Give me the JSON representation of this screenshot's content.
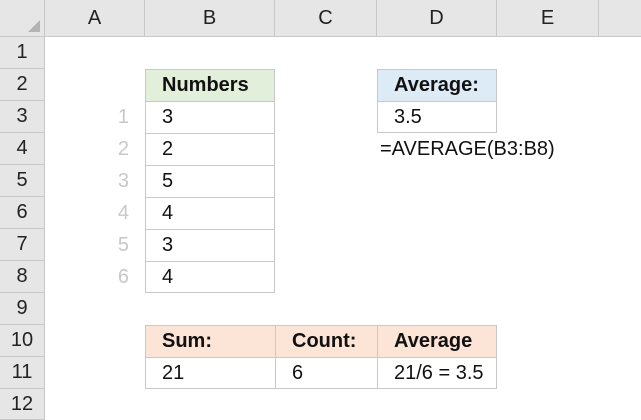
{
  "columns": [
    "A",
    "B",
    "C",
    "D",
    "E"
  ],
  "rows": [
    "1",
    "2",
    "3",
    "4",
    "5",
    "6",
    "7",
    "8",
    "9",
    "10",
    "11",
    "12"
  ],
  "numbers_table": {
    "header": "Numbers",
    "index": [
      "1",
      "2",
      "3",
      "4",
      "5",
      "6"
    ],
    "values": [
      "3",
      "2",
      "5",
      "4",
      "3",
      "4"
    ]
  },
  "average_box": {
    "header": "Average:",
    "value": "3.5",
    "formula": "=AVERAGE(B3:B8)"
  },
  "summary_table": {
    "headers": [
      "Sum:",
      "Count:",
      "Average"
    ],
    "values": [
      "21",
      "6",
      "21/6 = 3.5"
    ]
  },
  "colors": {
    "header_bg": "#e6e6e6",
    "numbers_header": "#e2efda",
    "average_header": "#ddebf7",
    "summary_header": "#fce4d6"
  }
}
